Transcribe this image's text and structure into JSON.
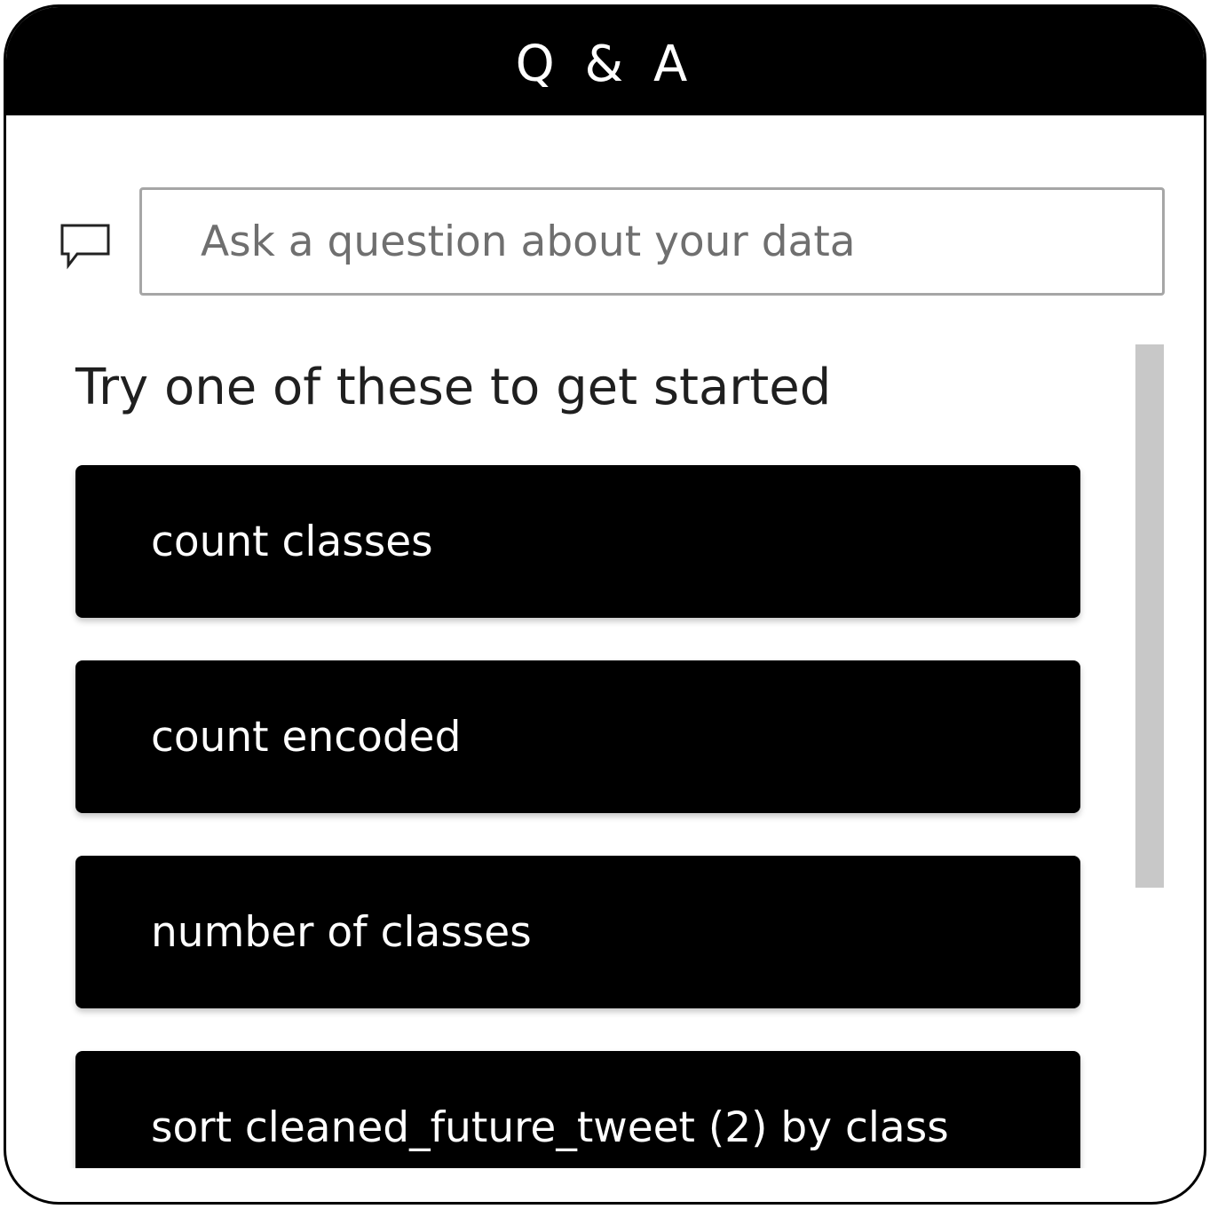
{
  "header": {
    "title": "Q & A"
  },
  "search": {
    "placeholder": "Ask a question about your data",
    "icon": "chat-bubble-icon"
  },
  "suggestions": {
    "heading": "Try one of these to get started",
    "items": [
      {
        "label": "count classes"
      },
      {
        "label": "count encoded"
      },
      {
        "label": "number of classes"
      },
      {
        "label": "sort cleaned_future_tweet (2) by class"
      }
    ]
  },
  "colors": {
    "header_bg": "#000000",
    "header_text": "#ffffff",
    "suggestion_bg": "#000000",
    "suggestion_text": "#ffffff",
    "search_border": "#a6a6a6",
    "scrollbar": "#c8c8c8"
  }
}
